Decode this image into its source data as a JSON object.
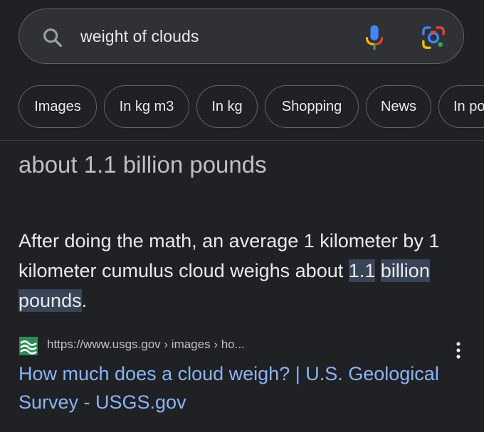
{
  "search": {
    "query": "weight of clouds"
  },
  "chips": [
    {
      "label": "Images"
    },
    {
      "label": "In kg m3"
    },
    {
      "label": "In kg"
    },
    {
      "label": "Shopping"
    },
    {
      "label": "News"
    },
    {
      "label": "In po"
    }
  ],
  "answer": {
    "title": "about 1.1 billion pounds"
  },
  "snippet": {
    "text_before": "After doing the math, an average 1 kilometer by 1 kilometer cumulus cloud weighs about ",
    "highlight_1": "1.1",
    "highlight_2": "billion pounds",
    "text_after": "."
  },
  "result": {
    "url": "https://www.usgs.gov › images › ho...",
    "title": "How much does a cloud weigh? | U.S. Geological Survey - USGS.gov"
  },
  "colors": {
    "background": "#202124",
    "link": "#8ab4f8",
    "highlight": "#394457",
    "usgs_green": "#2e8b57"
  },
  "icons": {
    "search": "search-icon",
    "mic": "microphone-icon",
    "lens": "google-lens-icon",
    "favicon": "usgs-favicon-icon",
    "more": "more-vert-icon"
  }
}
